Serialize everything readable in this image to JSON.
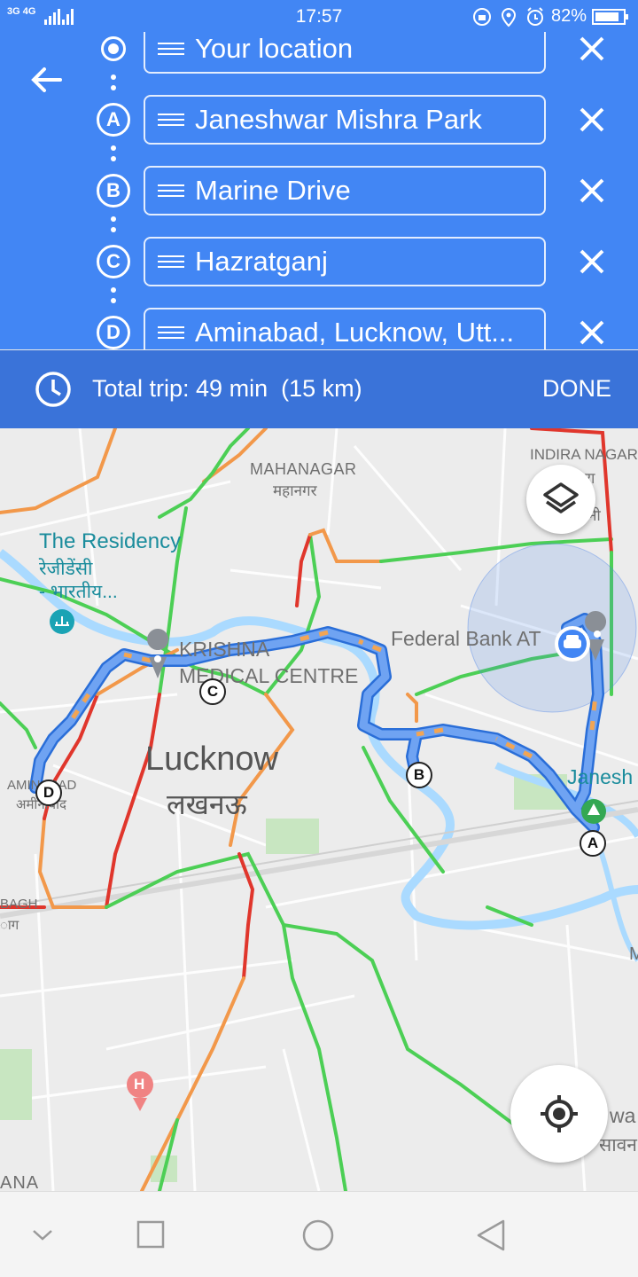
{
  "status_bar": {
    "network": "3G 4G",
    "time": "17:57",
    "battery_percent": "82%"
  },
  "directions": {
    "stops": [
      {
        "marker": "",
        "value": "Your location"
      },
      {
        "marker": "A",
        "value": "Janeshwar Mishra Park"
      },
      {
        "marker": "B",
        "value": "Marine Drive"
      },
      {
        "marker": "C",
        "value": "Hazratganj"
      },
      {
        "marker": "D",
        "value": "Aminabad, Lucknow, Utt..."
      }
    ]
  },
  "trip": {
    "summary": "Total trip: 49 min  (15 km)",
    "done_label": "DONE"
  },
  "map": {
    "labels": {
      "mahanagar_en": "MAHANAGAR",
      "mahanagar_hi": "महानगर",
      "indira_nagar": "INDIRA NAGAR",
      "indira_nagar_hi": "रा",
      "indira_nagar_hi2": "नी",
      "residency_en": "The Residency",
      "residency_hi": "रेजीडेंसी",
      "residency_hi2": "- भारतीय...",
      "krishna_1": "KRISHNA",
      "krishna_2": "MEDICAL CENTRE",
      "federal_bank": "Federal Bank AT",
      "city_en": "Lucknow",
      "city_hi": "लखनऊ",
      "aminabad_en": "AMINABAD",
      "aminabad_hi": "अमीनाबाद",
      "janesh": "Janesh",
      "bagh": "BAGH",
      "bagh_hi": "ाग",
      "right_m": "M",
      "right_wa": "wa",
      "right_hi": "सावन",
      "bottom_ana": "ANA"
    },
    "pins": {
      "A": "A",
      "B": "B",
      "C": "C",
      "D": "D"
    },
    "hospital": "H"
  },
  "colors": {
    "header_blue": "#4286f4",
    "trip_blue": "#3a73d9",
    "route_blue": "#6fa3f2",
    "traffic_green": "#4ccf55",
    "traffic_orange": "#f2984a",
    "traffic_red": "#e0362c"
  }
}
